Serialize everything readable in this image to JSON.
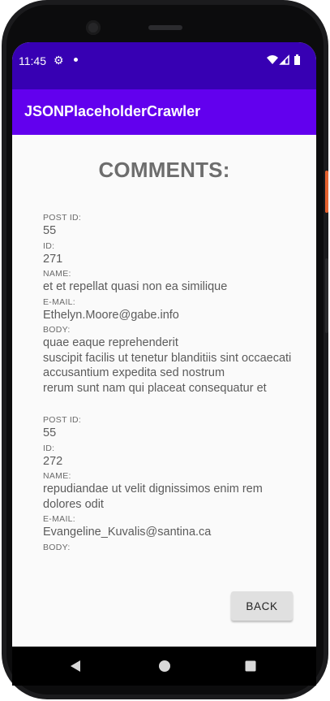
{
  "status_bar": {
    "time": "11:45",
    "icons": [
      "gear-icon",
      "notification-dot-icon",
      "wifi-icon",
      "signal-icon",
      "battery-icon"
    ]
  },
  "app_bar": {
    "title": "JSONPlaceholderCrawler"
  },
  "page": {
    "title": "COMMENTS:"
  },
  "labels": {
    "post_id": "POST ID:",
    "id": "ID:",
    "name": "NAME:",
    "email": "E-MAIL:",
    "body": "BODY:"
  },
  "comments": [
    {
      "post_id": "55",
      "id": "271",
      "name": "et et repellat quasi non ea similique",
      "email": "Ethelyn.Moore@gabe.info",
      "body": "quae eaque reprehenderit\nsuscipit facilis ut tenetur blanditiis sint occaecati\naccusantium expedita sed nostrum\nrerum sunt nam qui placeat consequatur et"
    },
    {
      "post_id": "55",
      "id": "272",
      "name": "repudiandae ut velit dignissimos enim rem dolores odit",
      "email": "Evangeline_Kuvalis@santina.ca",
      "body": ""
    }
  ],
  "buttons": {
    "back": "BACK"
  },
  "nav": [
    "back-triangle-icon",
    "home-circle-icon",
    "recents-square-icon"
  ],
  "colors": {
    "status_bar": "#3700b3",
    "app_bar": "#6200ee",
    "background": "#fafafa",
    "button": "#e0e0e0"
  }
}
